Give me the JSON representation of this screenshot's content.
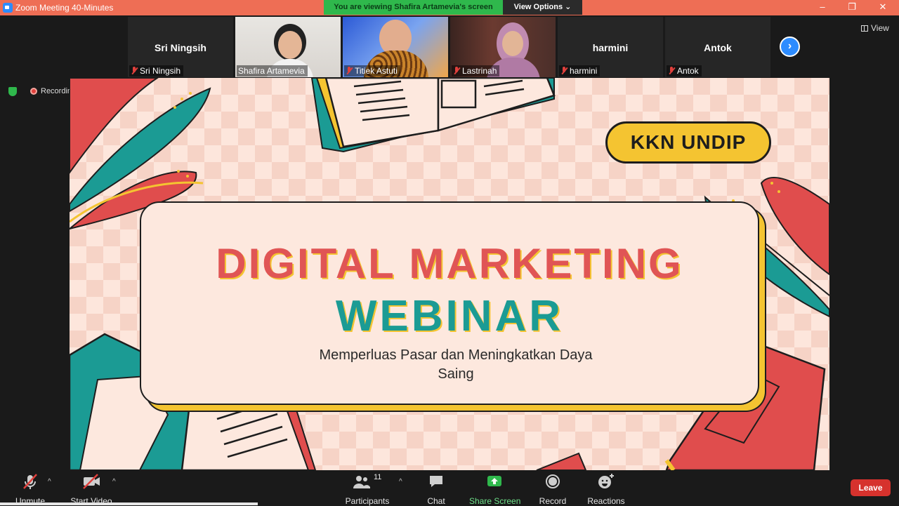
{
  "window": {
    "title": "Zoom Meeting 40-Minutes",
    "minimize": "–",
    "restore": "❐",
    "close": "✕"
  },
  "banner": {
    "viewing": "You are viewing Shafira Artamevia's screen",
    "view_options": "View Options ⌄"
  },
  "participants": [
    {
      "name": "Sri Ningsih",
      "center_name": "Sri Ningsih",
      "has_video": false
    },
    {
      "name": "Shafira Artamevia",
      "has_video": true
    },
    {
      "name": "Titiek Astuti",
      "has_video": true
    },
    {
      "name": "Lastrinah",
      "has_video": true
    },
    {
      "name": "harmini",
      "center_name": "harmini",
      "has_video": false
    },
    {
      "name": "Antok",
      "center_name": "Antok",
      "has_video": false
    }
  ],
  "strip": {
    "next": "›",
    "view_label": "View"
  },
  "status": {
    "recording": "Recording"
  },
  "slide": {
    "badge": "KKN UNDIP",
    "title_line1": "DIGITAL MARKETING",
    "title_line2": "WEBINAR",
    "subtitle_line1": "Memperluas Pasar dan Meningkatkan Daya",
    "subtitle_line2": "Saing",
    "colors": {
      "red": "#e05555",
      "teal": "#1b9b94",
      "yellow": "#f4c431",
      "background": "#fde6dc"
    }
  },
  "toolbar": {
    "unmute": "Unmute",
    "start_video": "Start Video",
    "participants": "Participants",
    "participants_count": "11",
    "chat": "Chat",
    "share_screen": "Share Screen",
    "record": "Record",
    "reactions": "Reactions",
    "leave": "Leave",
    "caret": "^"
  }
}
